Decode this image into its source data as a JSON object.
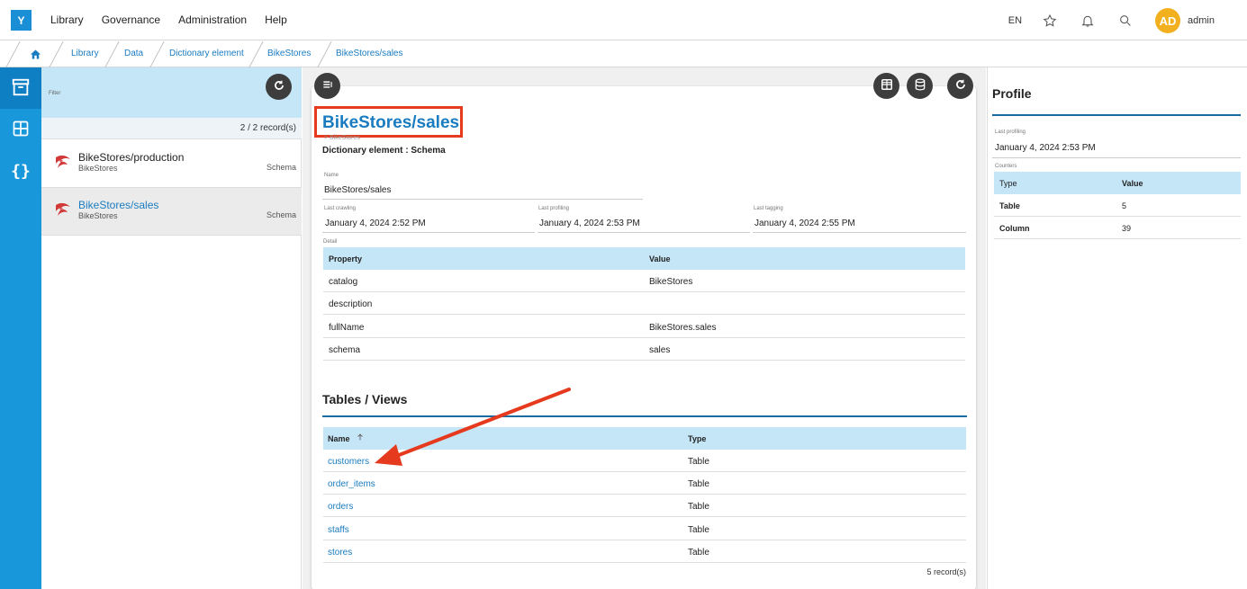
{
  "app": {
    "logo": "Y"
  },
  "topmenu": [
    "Library",
    "Governance",
    "Administration",
    "Help"
  ],
  "topright": {
    "lang": "EN",
    "avatar": "AD",
    "user": "admin"
  },
  "breadcrumb": [
    "Library",
    "Data",
    "Dictionary element",
    "BikeStores",
    "BikeStores/sales"
  ],
  "leftpanel": {
    "filter_label": "Filter",
    "records": "2 / 2 record(s)",
    "items": [
      {
        "name": "BikeStores/production",
        "sub": "BikeStores",
        "type": "Schema",
        "selected": false
      },
      {
        "name": "BikeStores/sales",
        "sub": "BikeStores",
        "type": "Schema",
        "selected": true
      }
    ]
  },
  "detail": {
    "title": "BikeStores/sales",
    "path_hint": "> BikeStores",
    "subtitle": "Dictionary element : Schema",
    "name_label": "Name",
    "name_value": "BikeStores/sales",
    "last_crawling_label": "Last crawling",
    "last_crawling": "January 4, 2024 2:52 PM",
    "last_profiling_label": "Last profiling",
    "last_profiling": "January 4, 2024 2:53 PM",
    "last_tagging_label": "Last tagging",
    "last_tagging": "January 4, 2024 2:55 PM",
    "detail_label": "Detail",
    "props_header": [
      "Property",
      "Value"
    ],
    "props": [
      [
        "catalog",
        "BikeStores"
      ],
      [
        "description",
        ""
      ],
      [
        "fullName",
        "BikeStores.sales"
      ],
      [
        "schema",
        "sales"
      ]
    ],
    "tables_title": "Tables / Views",
    "tables_header": [
      "Name",
      "Type"
    ],
    "tables": [
      [
        "customers",
        "Table"
      ],
      [
        "order_items",
        "Table"
      ],
      [
        "orders",
        "Table"
      ],
      [
        "staffs",
        "Table"
      ],
      [
        "stores",
        "Table"
      ]
    ],
    "tables_count": "5 record(s)"
  },
  "profile": {
    "title": "Profile",
    "last_profiling_label": "Last profiling",
    "last_profiling": "January 4, 2024 2:53 PM",
    "counters_label": "Counters",
    "header": [
      "Type",
      "Value"
    ],
    "rows": [
      [
        "Table",
        "5"
      ],
      [
        "Column",
        "39"
      ]
    ]
  },
  "colors": {
    "accent": "#1a7cc0",
    "rail": "#1898db",
    "highlight": "#e53a1e",
    "tablehead": "#c5e6f7"
  }
}
